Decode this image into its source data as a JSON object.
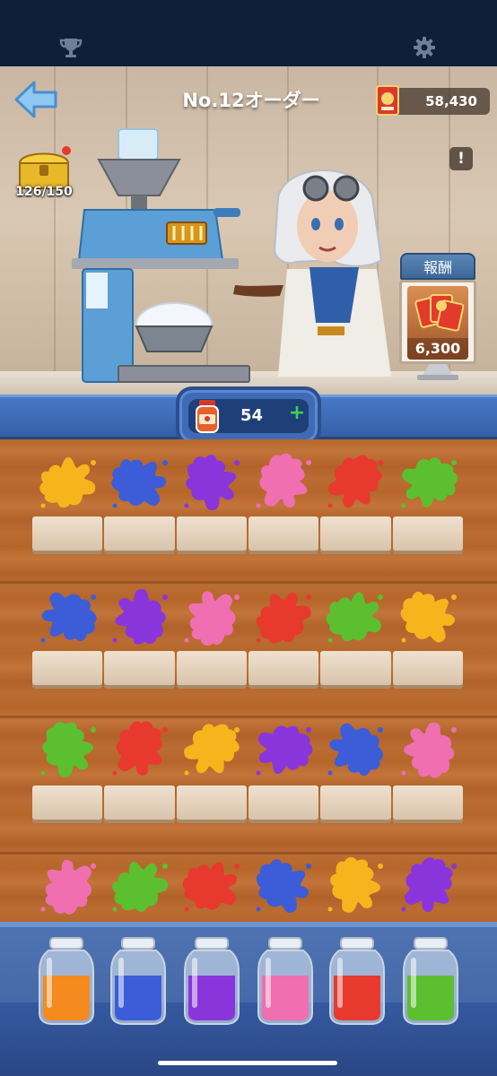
{
  "header": {
    "title": "No.12オーダー",
    "coins": "58,430",
    "chest_count": "126/150",
    "alert_label": "!"
  },
  "reward": {
    "label": "報酬",
    "value": "6,300"
  },
  "jam": {
    "count": "54",
    "plus": "+"
  },
  "icons": [
    "trophy-icon",
    "gear-icon",
    "back-arrow-icon",
    "coin-card-icon",
    "chest-icon",
    "alert-icon",
    "jam-jar-icon",
    "plus-icon"
  ],
  "colors": {
    "yellow": "#f6b51c",
    "blue": "#3d5cd8",
    "purple": "#8a35dc",
    "pink": "#ef6fb0",
    "red": "#e8392e",
    "green": "#5cbf2f",
    "orange": "#f58a1e"
  },
  "board": {
    "rows": [
      [
        "yellow",
        "blue",
        "purple",
        "pink",
        "red",
        "green"
      ],
      [
        "blue",
        "purple",
        "pink",
        "red",
        "green",
        "yellow"
      ],
      [
        "green",
        "red",
        "yellow",
        "purple",
        "blue",
        "pink"
      ],
      [
        "pink",
        "green",
        "red",
        "blue",
        "yellow",
        "purple"
      ]
    ]
  },
  "jars": [
    "orange",
    "blue",
    "purple",
    "pink",
    "red",
    "green"
  ]
}
